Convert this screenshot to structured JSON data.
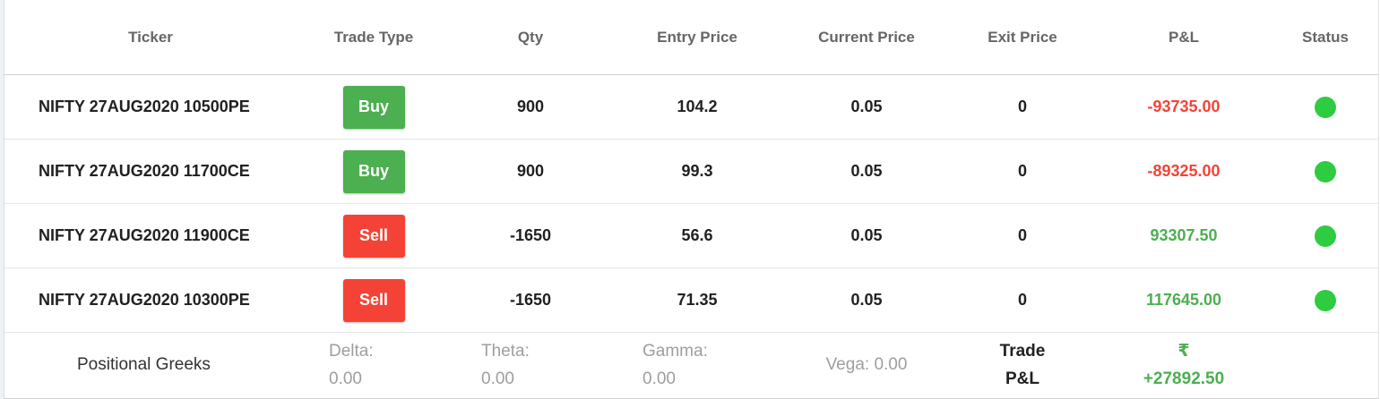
{
  "table": {
    "headers": [
      "Ticker",
      "Trade Type",
      "Qty",
      "Entry Price",
      "Current Price",
      "Exit Price",
      "P&L",
      "Status"
    ],
    "rows": [
      {
        "ticker": "NIFTY 27AUG2020 10500PE",
        "trade_type": "Buy",
        "qty": "900",
        "entry_price": "104.2",
        "current_price": "0.05",
        "exit_price": "0",
        "pnl": "-93735.00",
        "status": "active"
      },
      {
        "ticker": "NIFTY 27AUG2020 11700CE",
        "trade_type": "Buy",
        "qty": "900",
        "entry_price": "99.3",
        "current_price": "0.05",
        "exit_price": "0",
        "pnl": "-89325.00",
        "status": "active"
      },
      {
        "ticker": "NIFTY 27AUG2020 11900CE",
        "trade_type": "Sell",
        "qty": "-1650",
        "entry_price": "56.6",
        "current_price": "0.05",
        "exit_price": "0",
        "pnl": "93307.50",
        "status": "active"
      },
      {
        "ticker": "NIFTY 27AUG2020 10300PE",
        "trade_type": "Sell",
        "qty": "-1650",
        "entry_price": "71.35",
        "current_price": "0.05",
        "exit_price": "0",
        "pnl": "117645.00",
        "status": "active"
      }
    ]
  },
  "footer": {
    "label": "Positional Greeks",
    "delta_label": "Delta:",
    "delta_value": "0.00",
    "theta_label": "Theta:",
    "theta_value": "0.00",
    "gamma_label": "Gamma:",
    "gamma_value": "0.00",
    "vega": "Vega: 0.00",
    "trade_pnl_label_1": "Trade",
    "trade_pnl_label_2": "P&L",
    "currency_symbol": "₹",
    "trade_pnl_value": "+27892.50"
  },
  "colors": {
    "buy": "#4caf50",
    "sell": "#f44336",
    "profit": "#4caf50",
    "loss": "#f44336",
    "status_active": "#2ecc40"
  }
}
